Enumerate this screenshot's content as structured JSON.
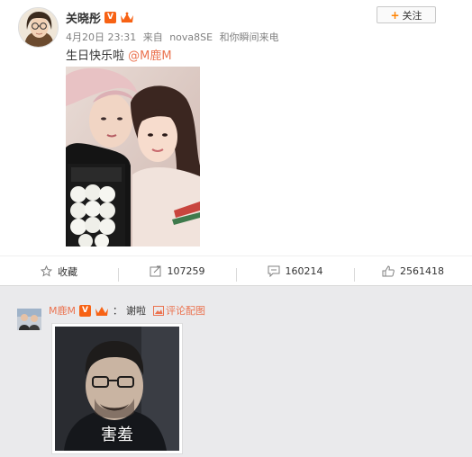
{
  "post": {
    "author": "关晓彤",
    "date": "4月20日 23:31",
    "source_prefix": "来自",
    "source": "nova8SE",
    "source_suffix": "和你瞬间来电",
    "text": "生日快乐啦",
    "mention": "@M鹿M",
    "follow_label": "关注"
  },
  "actions": [
    {
      "label": "收藏",
      "icon": "star-icon"
    },
    {
      "label": "107259",
      "icon": "share-icon"
    },
    {
      "label": "160214",
      "icon": "comment-icon"
    },
    {
      "label": "2561418",
      "icon": "like-icon"
    }
  ],
  "reply": {
    "user": "M鹿M",
    "separator": "：",
    "text": "谢啦",
    "pic_comment_label": "评论配图",
    "sticker_caption": "害羞"
  },
  "colors": {
    "accent": "#eb7350",
    "vip": "#f76214",
    "follow_plus": "#ff8200"
  }
}
